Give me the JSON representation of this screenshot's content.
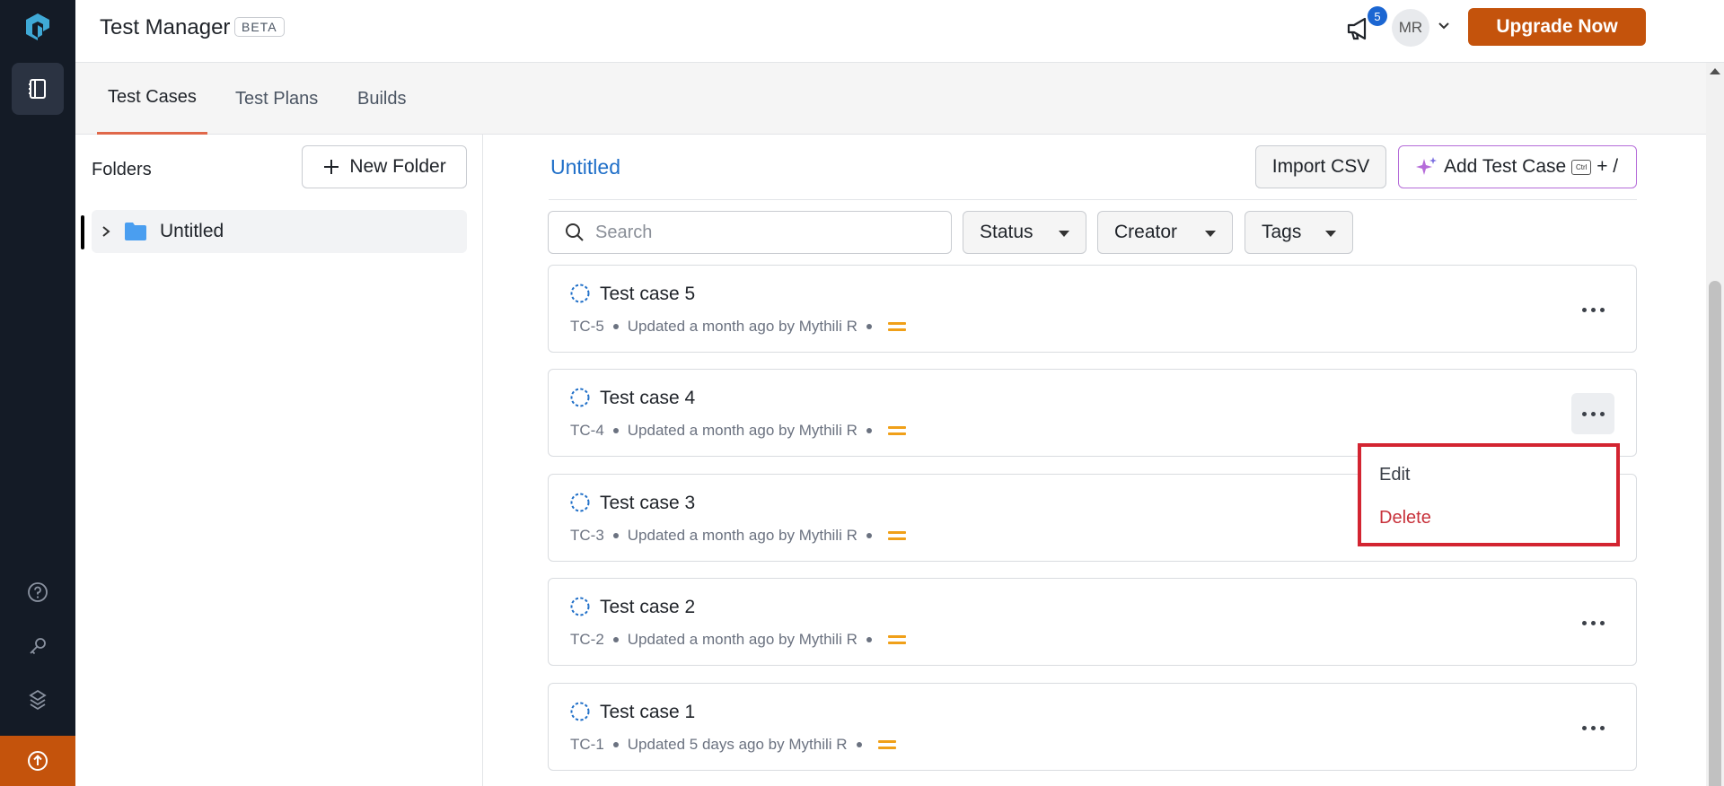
{
  "app": {
    "title": "Test Manager",
    "beta_label": "BETA"
  },
  "header": {
    "notification_count": "5",
    "avatar_initials": "MR",
    "upgrade_label": "Upgrade Now"
  },
  "tabs": [
    {
      "label": "Test Cases",
      "active": true
    },
    {
      "label": "Test Plans",
      "active": false
    },
    {
      "label": "Builds",
      "active": false
    }
  ],
  "folders": {
    "title": "Folders",
    "new_folder_label": "New Folder",
    "items": [
      {
        "label": "Untitled"
      }
    ]
  },
  "main": {
    "title": "Untitled",
    "import_label": "Import CSV",
    "add_label": "Add Test Case",
    "shortcut": {
      "key": "Ctrl",
      "suffix": "+ /"
    },
    "search_placeholder": "Search",
    "filters": [
      "Status",
      "Creator",
      "Tags"
    ]
  },
  "test_cases": [
    {
      "title": "Test case 5",
      "id": "TC-5",
      "updated": "Updated a month ago by Mythili R"
    },
    {
      "title": "Test case 4",
      "id": "TC-4",
      "updated": "Updated a month ago by Mythili R"
    },
    {
      "title": "Test case 3",
      "id": "TC-3",
      "updated": "Updated a month ago by Mythili R"
    },
    {
      "title": "Test case 2",
      "id": "TC-2",
      "updated": "Updated a month ago by Mythili R"
    },
    {
      "title": "Test case 1",
      "id": "TC-1",
      "updated": "Updated 5 days ago by Mythili R"
    }
  ],
  "context_menu": {
    "edit_label": "Edit",
    "delete_label": "Delete"
  },
  "colors": {
    "rail_bg": "#141b26",
    "brand_orange": "#c4530c",
    "link_blue": "#1f6fc8",
    "priority": "#f0a019",
    "delete_red": "#c8323b",
    "highlight_border": "#d32431"
  },
  "icons": [
    "logo-icon",
    "test-manager-icon",
    "help-icon",
    "key-icon",
    "integrations-icon",
    "upload-icon",
    "megaphone-icon",
    "chevron-down-icon",
    "plus-icon",
    "chevron-right-icon",
    "folder-icon",
    "search-icon",
    "sparkle-icon",
    "status-icon",
    "more-icon"
  ]
}
